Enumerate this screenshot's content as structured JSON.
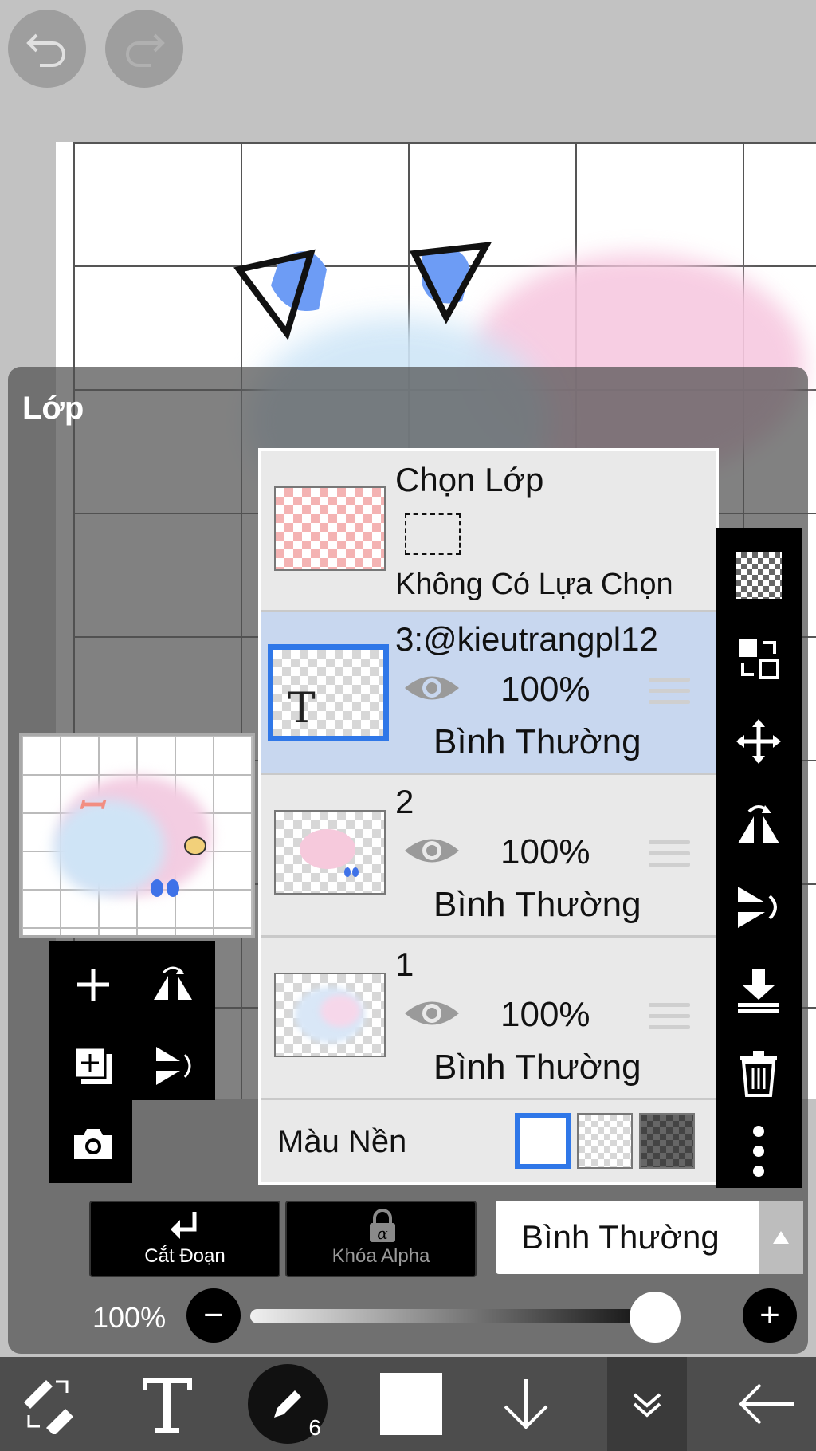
{
  "colors": {
    "accent_blue": "#2f77e8",
    "selected_row": "#c8d7ef",
    "panel_bg": "rgba(80,80,80,0.72)"
  },
  "icons": {
    "undo": "undo-icon",
    "redo": "redo-icon",
    "add": "plus-icon",
    "flip_h": "flip-horizontal-icon",
    "add_copy": "duplicate-layer-icon",
    "flip_v": "flip-vertical-icon",
    "camera": "camera-icon",
    "transparent": "checker-icon",
    "swap": "swap-icon",
    "move": "move-icon",
    "merge_down": "merge-down-icon",
    "trash": "trash-icon",
    "more": "more-vertical-icon",
    "eye": "eye-icon",
    "clip": "clip-arrow-icon",
    "lock": "lock-icon"
  },
  "panel": {
    "title": "Lớp"
  },
  "selection_row": {
    "name": "Chọn Lớp",
    "status": "Không Có Lựa Chọn"
  },
  "layers": [
    {
      "name": "3:@kieutrangpl12",
      "opacity": "100%",
      "blend": "Bình Thường",
      "selected": true,
      "thumb_letter": "T"
    },
    {
      "name": "2",
      "opacity": "100%",
      "blend": "Bình Thường",
      "selected": false
    },
    {
      "name": "1",
      "opacity": "100%",
      "blend": "Bình Thường",
      "selected": false
    }
  ],
  "background_row": {
    "label": "Màu Nền"
  },
  "buttons": {
    "clip": "Cắt Đoạn",
    "alpha_lock": "Khóa Alpha"
  },
  "blend_mode": {
    "value": "Bình Thường"
  },
  "opacity": {
    "label": "100%",
    "value": 1.0,
    "minus": "−",
    "plus": "+"
  },
  "bottom_toolbar": {
    "brush_size": "6"
  }
}
